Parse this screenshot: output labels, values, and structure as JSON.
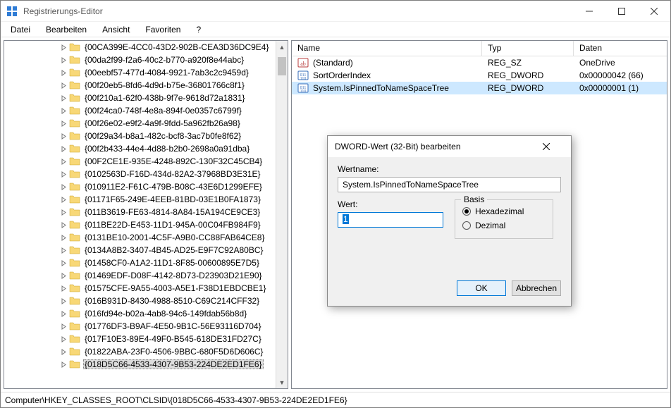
{
  "window": {
    "title": "Registrierungs-Editor"
  },
  "menu": {
    "file": "Datei",
    "edit": "Bearbeiten",
    "view": "Ansicht",
    "favorites": "Favoriten",
    "help": "?"
  },
  "tree": {
    "items": [
      "{00CA399E-4CC0-43D2-902B-CEA3D36DC9E4}",
      "{00da2f99-f2a6-40c2-b770-a920f8e44abc}",
      "{00eebf57-477d-4084-9921-7ab3c2c9459d}",
      "{00f20eb5-8fd6-4d9d-b75e-36801766c8f1}",
      "{00f210a1-62f0-438b-9f7e-9618d72a1831}",
      "{00f24ca0-748f-4e8a-894f-0e0357c6799f}",
      "{00f26e02-e9f2-4a9f-9fdd-5a962fb26a98}",
      "{00f29a34-b8a1-482c-bcf8-3ac7b0fe8f62}",
      "{00f2b433-44e4-4d88-b2b0-2698a0a91dba}",
      "{00F2CE1E-935E-4248-892C-130F32C45CB4}",
      "{0102563D-F16D-434d-82A2-37968BD3E31E}",
      "{010911E2-F61C-479B-B08C-43E6D1299EFE}",
      "{01171F65-249E-4EEB-81BD-03E1B0FA1873}",
      "{011B3619-FE63-4814-8A84-15A194CE9CE3}",
      "{011BE22D-E453-11D1-945A-00C04FB984F9}",
      "{0131BE10-2001-4C5F-A9B0-CC88FAB64CE8}",
      "{0134A8B2-3407-4B45-AD25-E9F7C92A80BC}",
      "{01458CF0-A1A2-11D1-8F85-00600895E7D5}",
      "{01469EDF-D08F-4142-8D73-D23903D21E90}",
      "{01575CFE-9A55-4003-A5E1-F38D1EBDCBE1}",
      "{016B931D-8430-4988-8510-C69C214CFF32}",
      "{016fd94e-b02a-4ab8-94c6-149fdab56b8d}",
      "{01776DF3-B9AF-4E50-9B1C-56E93116D704}",
      "{017F10E3-89E4-49F0-B545-618DE31FD27C}",
      "{01822ABA-23F0-4506-9BBC-680F5D6D606C}",
      "{018D5C66-4533-4307-9B53-224DE2ED1FE6}"
    ],
    "selected_index": 25
  },
  "list": {
    "headers": {
      "name": "Name",
      "type": "Typ",
      "data": "Daten"
    },
    "rows": [
      {
        "icon": "sz",
        "name": "(Standard)",
        "type": "REG_SZ",
        "data": "OneDrive",
        "selected": false
      },
      {
        "icon": "dw",
        "name": "SortOrderIndex",
        "type": "REG_DWORD",
        "data": "0x00000042 (66)",
        "selected": false
      },
      {
        "icon": "dw",
        "name": "System.IsPinnedToNameSpaceTree",
        "type": "REG_DWORD",
        "data": "0x00000001 (1)",
        "selected": true
      }
    ]
  },
  "dialog": {
    "title": "DWORD-Wert (32-Bit) bearbeiten",
    "name_label": "Wertname:",
    "name_value": "System.IsPinnedToNameSpaceTree",
    "value_label": "Wert:",
    "value": "1",
    "basis_label": "Basis",
    "radio_hex": "Hexadezimal",
    "radio_dec": "Dezimal",
    "basis_selected": "hex",
    "ok": "OK",
    "cancel": "Abbrechen"
  },
  "statusbar": {
    "path": "Computer\\HKEY_CLASSES_ROOT\\CLSID\\{018D5C66-4533-4307-9B53-224DE2ED1FE6}"
  }
}
